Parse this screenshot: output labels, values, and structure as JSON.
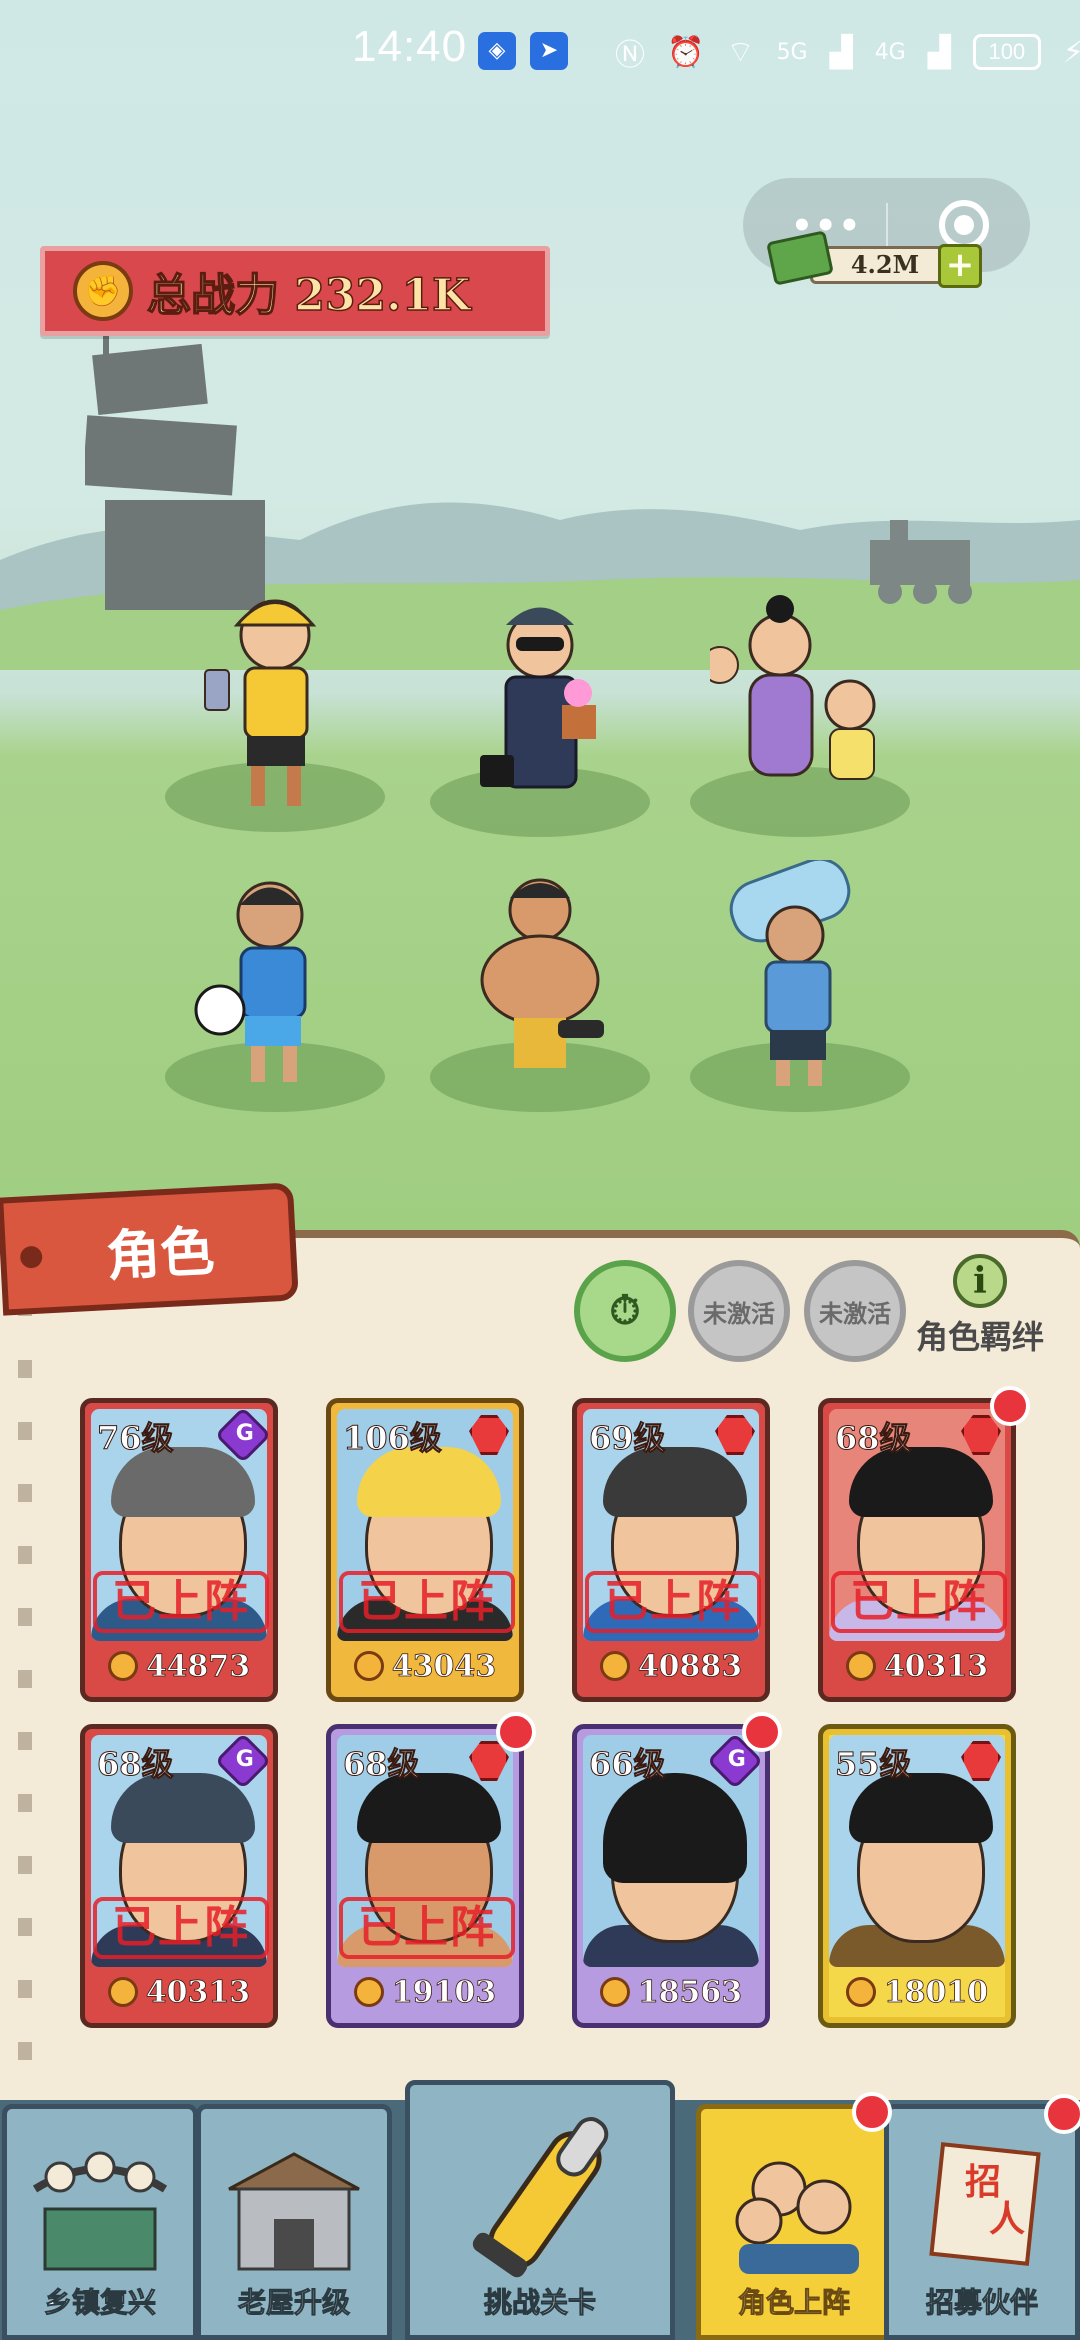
{
  "status_bar": {
    "time": "14:40",
    "network_5g": "5G",
    "network_4g": "4G",
    "battery": "100"
  },
  "header": {
    "total_power_label": "总战力 232.1K",
    "currency": "4.2M"
  },
  "panel": {
    "title": "角色",
    "filters": [
      {
        "label": "",
        "icon": "clock-icon",
        "active": true
      },
      {
        "label": "未激活",
        "icon": "building-icon",
        "active": false
      },
      {
        "label": "未激活",
        "icon": "swirl-icon",
        "active": false
      }
    ],
    "bond_label": "角色羁绊"
  },
  "cards": [
    {
      "level": "76级",
      "power": "44873",
      "deployed_stamp": "已上阵",
      "badge": "g-icon",
      "color": "red"
    },
    {
      "level": "106级",
      "power": "43043",
      "deployed_stamp": "已上阵",
      "badge": "fist-red-icon",
      "color": "yellow"
    },
    {
      "level": "69级",
      "power": "40883",
      "deployed_stamp": "已上阵",
      "badge": "fist-red-icon",
      "color": "red"
    },
    {
      "level": "68级",
      "power": "40313",
      "deployed_stamp": "已上阵",
      "badge": "fist-red-icon",
      "color": "red"
    },
    {
      "level": "68级",
      "power": "40313",
      "deployed_stamp": "已上阵",
      "badge": "g-icon",
      "color": "red"
    },
    {
      "level": "68级",
      "power": "19103",
      "deployed_stamp": "已上阵",
      "badge": "fist-red-icon",
      "color": "purple"
    },
    {
      "level": "66级",
      "power": "18563",
      "deployed_stamp": "",
      "badge": "g-icon",
      "color": "purple"
    },
    {
      "level": "55级",
      "power": "18010",
      "deployed_stamp": "",
      "badge": "fist-red-icon",
      "color": "gold"
    }
  ],
  "nav": {
    "items": [
      {
        "label": "乡镇复兴"
      },
      {
        "label": "老屋升级"
      },
      {
        "label": "挑战关卡"
      },
      {
        "label": "角色上阵"
      },
      {
        "label": "招募伙伴"
      }
    ]
  },
  "colors": {
    "accent_red": "#d9484d",
    "panel_bg": "#f3ead7",
    "nav_active": "#f5cf3a"
  }
}
